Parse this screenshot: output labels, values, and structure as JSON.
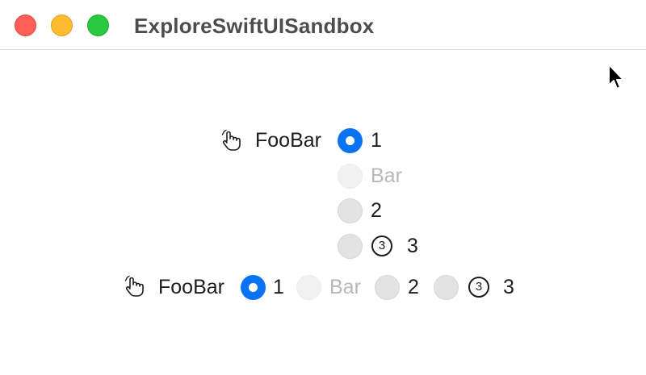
{
  "window": {
    "title": "ExploreSwiftUISandbox"
  },
  "icons": {
    "traffic_close": "close-icon",
    "traffic_minimize": "minimize-icon",
    "traffic_zoom": "zoom-icon",
    "pointer": "cursor-icon",
    "hand": "pointing-hand-icon",
    "circled_number": "circled-3-icon"
  },
  "colors": {
    "close": "#fe5f57",
    "minimize": "#febc2e",
    "zoom": "#28c840",
    "accent": "#0a73f4",
    "disabled_text": "#b8b8b8"
  },
  "vertical_picker": {
    "label": "FooBar",
    "options": [
      {
        "text": "1",
        "state": "selected"
      },
      {
        "text": "Bar",
        "state": "disabled"
      },
      {
        "text": "2",
        "state": "normal"
      },
      {
        "badge": "3",
        "text": "3",
        "state": "normal"
      }
    ]
  },
  "horizontal_picker": {
    "label": "FooBar",
    "options": [
      {
        "text": "1",
        "state": "selected"
      },
      {
        "text": "Bar",
        "state": "disabled"
      },
      {
        "text": "2",
        "state": "normal"
      },
      {
        "badge": "3",
        "text": "3",
        "state": "normal"
      }
    ]
  }
}
